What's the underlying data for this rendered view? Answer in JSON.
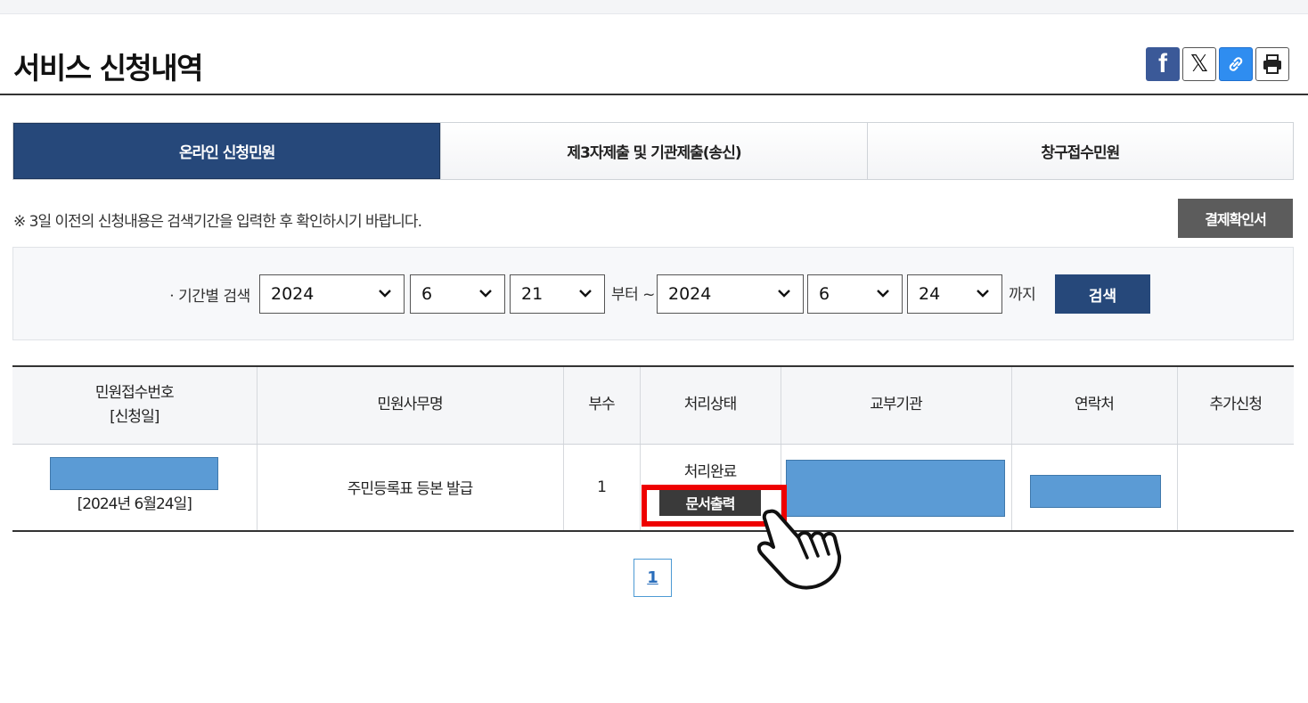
{
  "page": {
    "title": "서비스 신청내역"
  },
  "share": {
    "facebook_glyph": "f",
    "x_glyph": "𝕏",
    "icons": [
      "facebook-icon",
      "x-icon",
      "link-icon",
      "print-icon"
    ]
  },
  "tabs": [
    {
      "label": "온라인 신청민원",
      "active": true
    },
    {
      "label": "제3자제출 및 기관제출(송신)",
      "active": false
    },
    {
      "label": "창구접수민원",
      "active": false
    }
  ],
  "notice": "※ 3일 이전의 신청내용은 검색기간을 입력한 후 확인하시기 바랍니다.",
  "receipt_button": "결제확인서",
  "search": {
    "label": "ㆍ기간별 검색",
    "from": {
      "year": "2024",
      "month": "6",
      "day": "21"
    },
    "from_suffix": "부터 ~",
    "to": {
      "year": "2024",
      "month": "6",
      "day": "24"
    },
    "to_suffix": "까지",
    "button": "검색"
  },
  "table": {
    "headers": {
      "receipt_no": "민원접수번호",
      "receipt_date_label": "[신청일]",
      "service_name": "민원사무명",
      "copies": "부수",
      "status": "처리상태",
      "issuing_agency": "교부기관",
      "contact": "연락처",
      "additional": "추가신청"
    },
    "rows": [
      {
        "apply_date": "[2024년 6월24일]",
        "service_name": "주민등록표 등본 발급",
        "copies": "1",
        "status": "처리완료",
        "print_button": "문서출력"
      }
    ]
  },
  "pagination": {
    "current": "1"
  },
  "colors": {
    "primary": "#26487a",
    "redaction": "#5b9bd5",
    "highlight": "#ee0000",
    "facebook": "#3b5998",
    "link": "#2f8df0"
  }
}
